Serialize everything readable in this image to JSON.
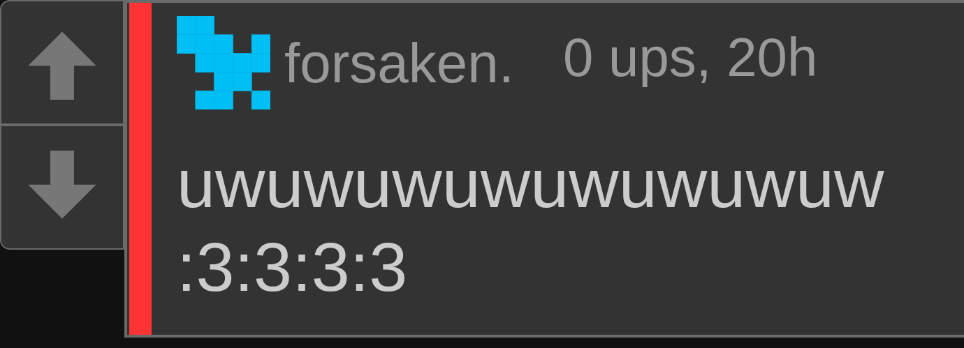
{
  "vote_buttons": [
    {
      "kind": "up"
    },
    {
      "kind": "down"
    }
  ],
  "comment": {
    "username": "forsaken.",
    "meta": "0 ups, 20h",
    "text": "uwuwuwuwuwuwuwuw :3:3:3:3"
  }
}
